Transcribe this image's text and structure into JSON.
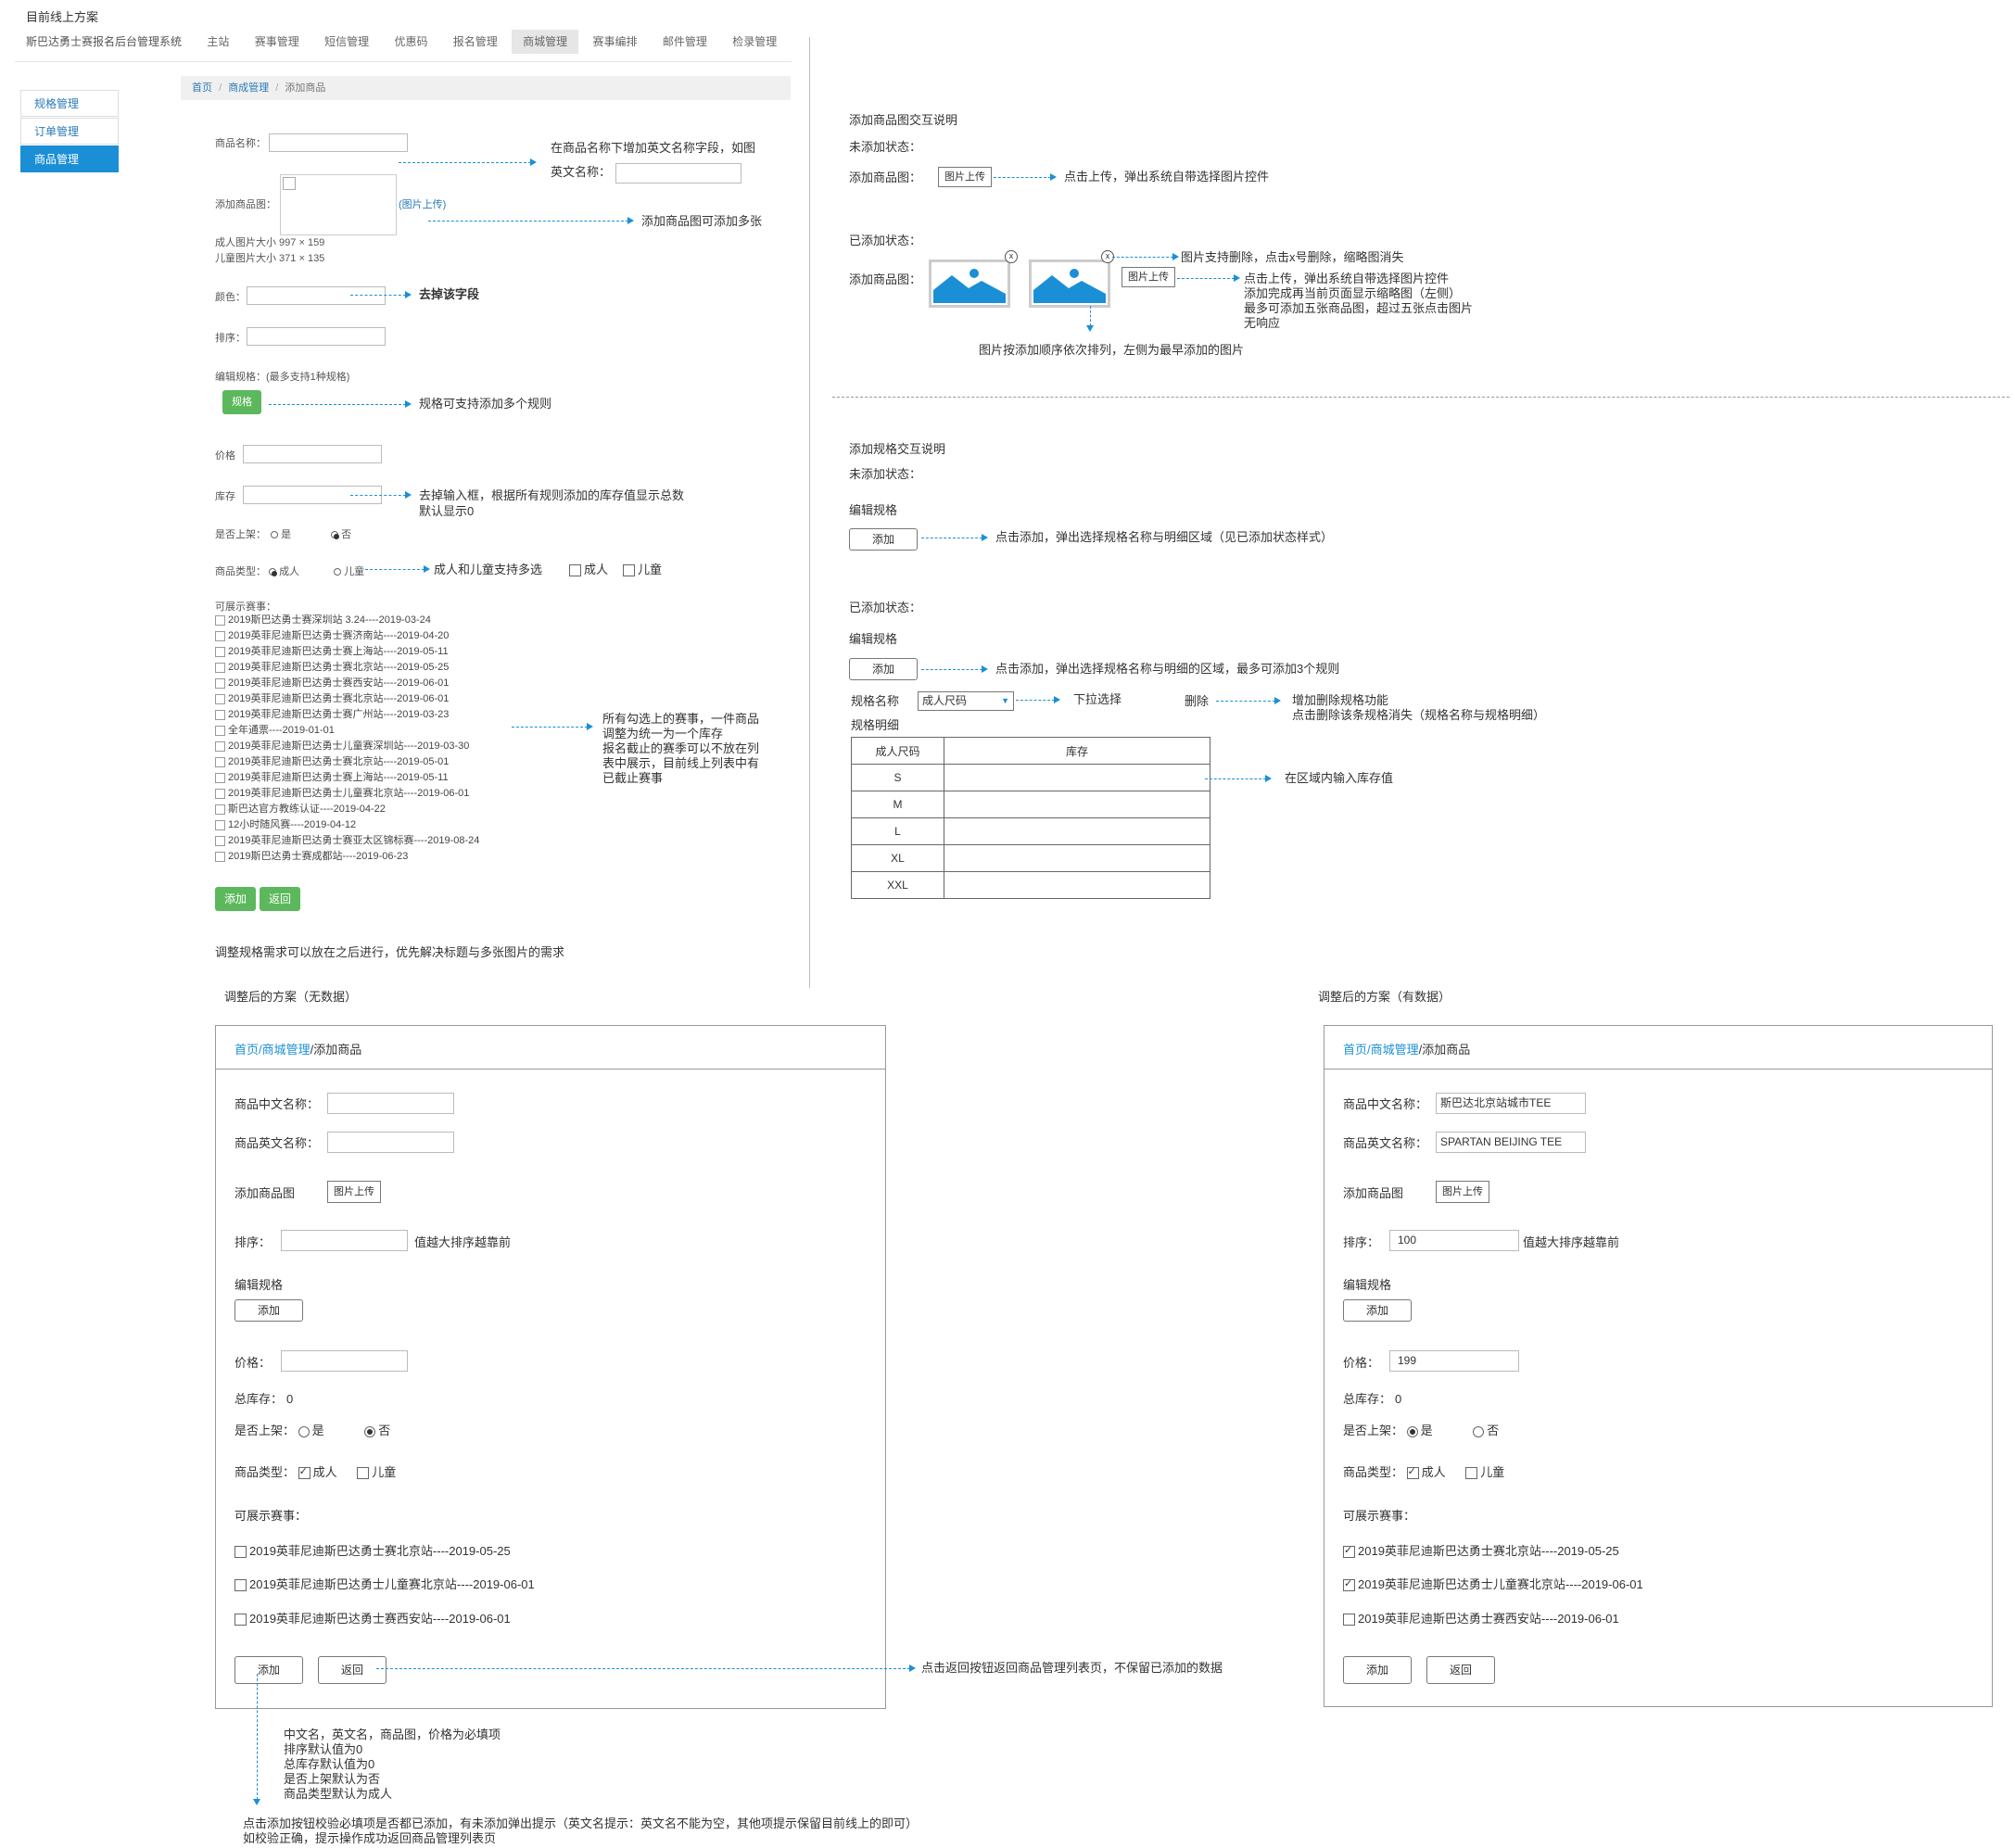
{
  "top_title": "目前线上方案",
  "nav": {
    "brand": "斯巴达勇士赛报名后台管理系统",
    "items": [
      "主站",
      "赛事管理",
      "短信管理",
      "优惠码",
      "报名管理",
      "商城管理",
      "赛事编排",
      "邮件管理",
      "检录管理"
    ],
    "active_index": 5
  },
  "breadcrumb": {
    "home": "首页",
    "sep": "/",
    "section": "商成管理",
    "current": "添加商品"
  },
  "sidebar": {
    "items": [
      {
        "label": "规格管理"
      },
      {
        "label": "订单管理"
      },
      {
        "label": "商品管理"
      }
    ],
    "active_index": 2
  },
  "old_form": {
    "name_label": "商品名称：",
    "image_label": "添加商品图：",
    "upload_link": "(图片上传)",
    "adult_size": "成人图片大小 997 × 159",
    "child_size": "儿童图片大小 371 × 135",
    "color_label": "颜色：",
    "sort_label": "排序：",
    "spec_label": "编辑规格：(最多支持1种规格)",
    "spec_button": "规格",
    "price_label": "价格",
    "stock_label": "库存",
    "onsale_label": "是否上架：",
    "onsale_yes": "是",
    "onsale_no": "否",
    "type_label": "商品类型：",
    "type_adult": "成人",
    "type_child": "儿童",
    "events_label": "可展示赛事：",
    "events": [
      "2019斯巴达勇士赛深圳站 3.24----2019-03-24",
      "2019英菲尼迪斯巴达勇士赛济南站----2019-04-20",
      "2019英菲尼迪斯巴达勇士赛上海站----2019-05-11",
      "2019英菲尼迪斯巴达勇士赛北京站----2019-05-25",
      "2019英菲尼迪斯巴达勇士赛西安站----2019-06-01",
      "2019英菲尼迪斯巴达勇士赛北京站----2019-06-01",
      "2019英菲尼迪斯巴达勇士赛广州站----2019-03-23",
      "全年通票----2019-01-01",
      "2019英菲尼迪斯巴达勇士儿童赛深圳站----2019-03-30",
      "2019英菲尼迪斯巴达勇士赛北京站----2019-05-01",
      "2019英菲尼迪斯巴达勇士赛上海站----2019-05-11",
      "2019英菲尼迪斯巴达勇士儿童赛北京站----2019-06-01",
      "斯巴达官方教练认证----2019-04-22",
      "12小时随风赛----2019-04-12",
      "2019英菲尼迪斯巴达勇士赛亚太区锦标赛----2019-08-24",
      "2019斯巴达勇士赛成都站----2019-06-23"
    ],
    "add_button": "添加",
    "back_button": "返回"
  },
  "old_notes": {
    "en_name_note": "在商品名称下增加英文名称字段，如图",
    "en_name_label": "英文名称：",
    "multi_image_note": "添加商品图可添加多张",
    "remove_field_note": "去掉该字段",
    "spec_multi_note": "规格可支持添加多个规则",
    "stock_note_1": "去掉输入框，根据所有规则添加的库存值显示总数",
    "stock_note_2": "默认显示0",
    "type_multi_note": "成人和儿童支持多选",
    "type_cb_adult": "成人",
    "type_cb_child": "儿童",
    "events_note": [
      "所有勾选上的赛事，一件商品",
      "调整为统一为一个库存",
      "报名截止的赛季可以不放在列",
      "表中展示，目前线上列表中有",
      "已截止赛事"
    ],
    "bottom_note": "调整规格需求可以放在之后进行，优先解决标题与多张图片的需求"
  },
  "image_interaction": {
    "title": "添加商品图交互说明",
    "not_added": "未添加状态：",
    "label": "添加商品图：",
    "upload_button": "图片上传",
    "upload_note": "点击上传，弹出系统自带选择图片控件",
    "added": "已添加状态：",
    "delete_note": "图片支持删除，点击x号删除，缩略图消失",
    "upload_note_2": [
      "点击上传，弹出系统自带选择图片控件",
      "添加完成再当前页面显示缩略图（左侧）",
      "最多可添加五张商品图，超过五张点击图片",
      "无响应"
    ],
    "order_note": "图片按添加顺序依次排列，左侧为最早添加的图片",
    "close_glyph": "x"
  },
  "spec_interaction": {
    "title": "添加规格交互说明",
    "not_added": "未添加状态：",
    "edit_spec": "编辑规格",
    "add_button": "添加",
    "add_note_1": "点击添加，弹出选择规格名称与明细区域（见已添加状态样式）",
    "added": "已添加状态：",
    "add_note_2": "点击添加，弹出选择规格名称与明细的区域，最多可添加3个规则",
    "name_label": "规格名称",
    "name_value": "成人尺码",
    "dropdown_note": "下拉选择",
    "delete_label": "删除",
    "delete_note_1": "增加删除规格功能",
    "delete_note_2": "点击删除该条规格消失（规格名称与规格明细）",
    "detail_label": "规格明细",
    "table_headers": [
      "成人尺码",
      "库存"
    ],
    "sizes": [
      "S",
      "M",
      "L",
      "XL",
      "XXL"
    ],
    "stock_note": "在区域内输入库存值"
  },
  "new_nodata": {
    "title": "调整后的方案（无数据）",
    "bc_home": "首页",
    "bc_section": "商城管理",
    "bc_current": "添加商品",
    "bc_sep": "/",
    "cn_name_label": "商品中文名称：",
    "en_name_label": "商品英文名称：",
    "image_label": "添加商品图",
    "upload_button": "图片上传",
    "sort_label": "排序：",
    "sort_hint": "值越大排序越靠前",
    "spec_label": "编辑规格",
    "spec_add": "添加",
    "price_label": "价格：",
    "stock_label": "总库存：",
    "stock_value": "0",
    "onsale_label": "是否上架：",
    "onsale_yes": "是",
    "onsale_no": "否",
    "type_label": "商品类型：",
    "type_adult": "成人",
    "type_child": "儿童",
    "events_label": "可展示赛事：",
    "events": [
      "2019英菲尼迪斯巴达勇士赛北京站----2019-05-25",
      "2019英菲尼迪斯巴达勇士儿童赛北京站----2019-06-01",
      "2019英菲尼迪斯巴达勇士赛西安站----2019-06-01"
    ],
    "add_button": "添加",
    "back_button": "返回",
    "back_note": "点击返回按钮返回商品管理列表页，不保留已添加的数据",
    "required_note": [
      "中文名，英文名，商品图，价格为必填项",
      "排序默认值为0",
      "总库存默认值为0",
      "是否上架默认为否",
      "商品类型默认为成人"
    ],
    "validate_note": [
      "点击添加按钮校验必填项是否都已添加，有未添加弹出提示（英文名提示：英文名不能为空，其他项提示保留目前线上的即可）",
      "如校验正确，提示操作成功返回商品管理列表页"
    ]
  },
  "new_data": {
    "title": "调整后的方案（有数据）",
    "bc_home": "首页",
    "bc_section": "商城管理",
    "bc_current": "添加商品",
    "bc_sep": "/",
    "cn_name_label": "商品中文名称：",
    "cn_name_value": "斯巴达北京站城市TEE",
    "en_name_label": "商品英文名称：",
    "en_name_value": "SPARTAN BEIJING TEE",
    "image_label": "添加商品图",
    "upload_button": "图片上传",
    "sort_label": "排序：",
    "sort_value": "100",
    "sort_hint": "值越大排序越靠前",
    "spec_label": "编辑规格",
    "spec_add": "添加",
    "price_label": "价格：",
    "price_value": "199",
    "stock_label": "总库存：",
    "stock_value": "0",
    "onsale_label": "是否上架：",
    "onsale_yes": "是",
    "onsale_no": "否",
    "type_label": "商品类型：",
    "type_adult": "成人",
    "type_child": "儿童",
    "events_label": "可展示赛事：",
    "events": [
      "2019英菲尼迪斯巴达勇士赛北京站----2019-05-25",
      "2019英菲尼迪斯巴达勇士儿童赛北京站----2019-06-01",
      "2019英菲尼迪斯巴达勇士赛西安站----2019-06-01"
    ],
    "add_button": "添加",
    "back_button": "返回"
  }
}
